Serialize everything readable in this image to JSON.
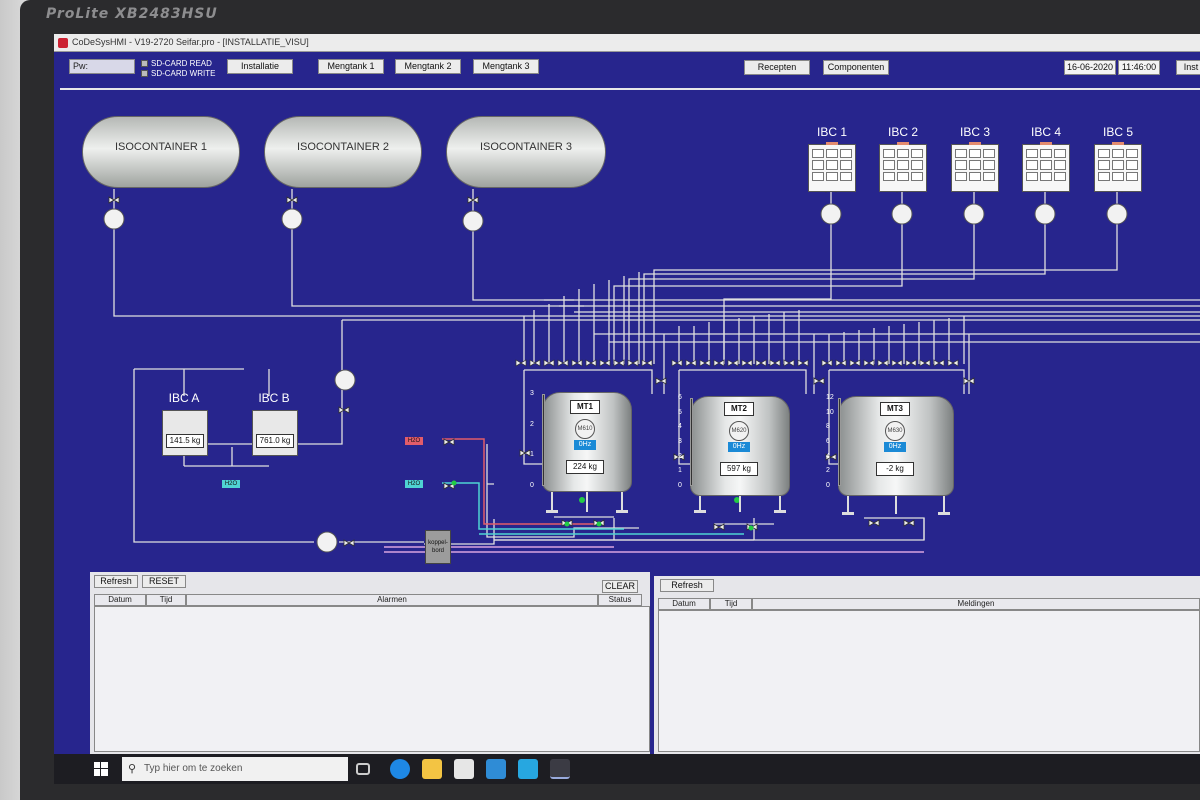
{
  "monitor": {
    "brand": "ProLite XB2483HSU"
  },
  "window": {
    "title": "CoDeSysHMI - V19-2720 Seifar.pro - [INSTALLATIE_VISU]"
  },
  "toolbar": {
    "pw_label": "Pw:",
    "sd_read": "SD-CARD READ",
    "sd_write": "SD-CARD WRITE",
    "installatie": "Installatie",
    "mengtank1": "Mengtank 1",
    "mengtank2": "Mengtank 2",
    "mengtank3": "Mengtank 3",
    "recepten": "Recepten",
    "componenten": "Componenten",
    "date": "16-06-2020",
    "time": "11:46:00",
    "inst": "Inst"
  },
  "isocontainers": [
    "ISOCONTAINER 1",
    "ISOCONTAINER 2",
    "ISOCONTAINER 3"
  ],
  "ibcs": [
    "IBC 1",
    "IBC 2",
    "IBC 3",
    "IBC 4",
    "IBC 5"
  ],
  "small_ibcs": [
    {
      "label": "IBC A",
      "weight": "141.5 kg"
    },
    {
      "label": "IBC B",
      "weight": "761.0 kg"
    }
  ],
  "h2o_tags": {
    "tag1": "H2O",
    "tag2": "H2O",
    "tag3": "H2O"
  },
  "koppelbord": {
    "line1": "koppel-",
    "line2": "bord"
  },
  "tanks": [
    {
      "name": "MT1",
      "motor": "M610",
      "hz": "0Hz",
      "weight": "224 kg",
      "scale": [
        "3",
        "2",
        "1",
        "0"
      ]
    },
    {
      "name": "MT2",
      "motor": "M620",
      "hz": "0Hz",
      "weight": "597 kg",
      "scale": [
        "6",
        "5",
        "4",
        "3",
        "2",
        "1",
        "0"
      ]
    },
    {
      "name": "MT3",
      "motor": "M630",
      "hz": "0Hz",
      "weight": "-2 kg",
      "scale": [
        "12",
        "10",
        "8",
        "6",
        "4",
        "2",
        "0"
      ]
    }
  ],
  "alarms": {
    "refresh": "Refresh",
    "reset": "RESET",
    "clear": "CLEAR",
    "col_datum": "Datum",
    "col_tijd": "Tijd",
    "col_alarmen": "Alarmen",
    "col_status": "Status"
  },
  "messages": {
    "refresh": "Refresh",
    "col_datum": "Datum",
    "col_tijd": "Tijd",
    "col_meldingen": "Meldingen"
  },
  "taskbar": {
    "search_placeholder": "Typ hier om te zoeken"
  },
  "colors": {
    "background": "#27258d",
    "pipe": "#e0e0e0",
    "h2o_hot": "#e25c6a",
    "h2o_cold": "#4fd3d3",
    "hz_badge": "#1b8ad6"
  }
}
